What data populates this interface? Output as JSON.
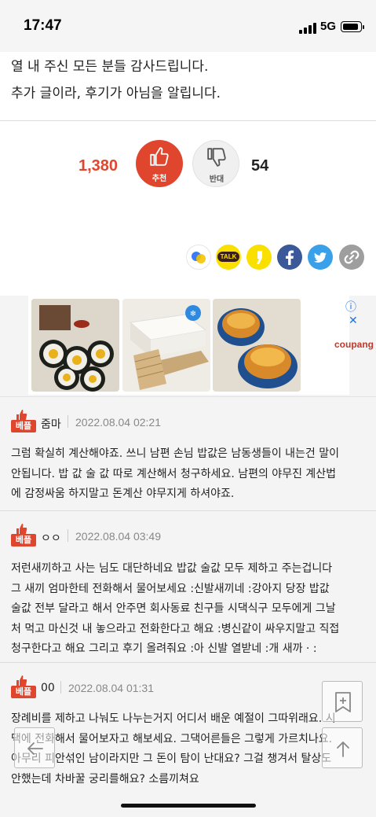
{
  "status_bar": {
    "time": "17:47",
    "network": "5G"
  },
  "article": {
    "line1": "열 내 주신 모든 분들 감사드립니다.",
    "line2": "추가 글이라, 후기가 아님을 알립니다."
  },
  "votes": {
    "up_count": "1,380",
    "up_label": "추천",
    "down_label": "반대",
    "down_count": "54"
  },
  "share": {
    "icons": [
      "share-icon",
      "kakaotalk-icon",
      "kakaostory-icon",
      "facebook-icon",
      "twitter-icon",
      "link-icon"
    ],
    "talk_label": "TALK",
    "colors": {
      "kakao_yellow": "#f9e000",
      "facebook": "#3b5998",
      "twitter": "#3aa0e9",
      "link": "#9e9e9e"
    }
  },
  "ad": {
    "brand": "coupang",
    "info_glyph": "ⓘ",
    "close_glyph": "✕"
  },
  "comments": [
    {
      "badge": "베플",
      "author": "줌마",
      "date": "2022.08.04 02:21",
      "lines": [
        "그럼 확실히 계산해야죠. 쓰니 남편 손님 밥값은 남동생들이 내는건 말이",
        "안됩니다. 밥 값 술 값 따로 계산해서 청구하세요. 남편의 야무진 계산법",
        "에 감정싸움 하지말고 돈계산 야무지게 하셔야죠."
      ]
    },
    {
      "badge": "베플",
      "author": "ㅇㅇ",
      "date": "2022.08.04 03:49",
      "lines": [
        "저런새끼하고 사는 님도 대단하네요 밥값 술값 모두 제하고 주는겁니다",
        "그 새끼 엄마한테 전화해서 물어보세요 :신발새끼네 :강아지 당장 밥값",
        "술값 전부 달라고 해서 안주면 회사동료 친구들 시댁식구 모두에게 그날",
        "처 먹고 마신것 내 놓으라고 전화한다고 해요 :병신같이 싸우지말고 직접",
        "청구한다고 해요 그리고 후기 올려줘요 :아 신발 열받네 :개 새까 ·   :"
      ]
    },
    {
      "badge": "베플",
      "author": "00",
      "date": "2022.08.04 01:31",
      "lines": [
        "장례비를 제하고 나눠도 나누는거지 어디서 배운 예절이 그따위래요. 시",
        "댁에 전화해서 물어보자고 해보세요. 그댁어른들은 그렇게 가르치나요.",
        "아무리 피안섞인 남이라지만 그 돈이 탐이 난대요? 그걸 챙겨서 탈상도",
        "안했는데 차바꿀 궁리를해요? 소름끼쳐요"
      ]
    }
  ]
}
